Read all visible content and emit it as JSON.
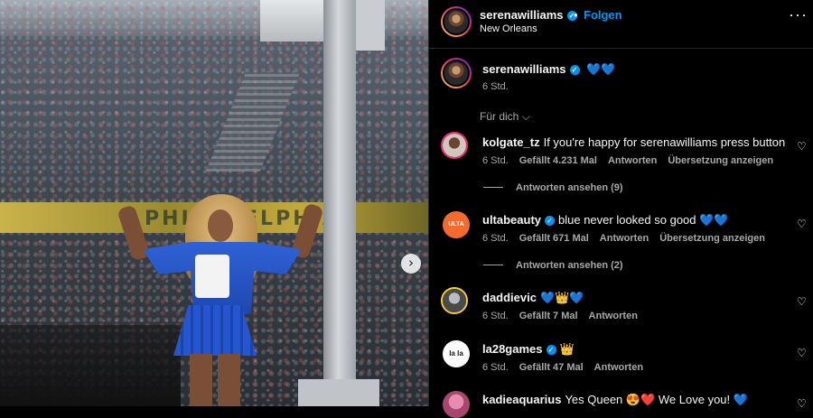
{
  "photo": {
    "banner_text": "PHILADELPHIA",
    "next_icon": "›"
  },
  "header": {
    "username": "serenawilliams",
    "verified_glyph": "✓",
    "dot": "•",
    "follow_label": "Folgen",
    "location": "New Orleans",
    "more_label": "···"
  },
  "caption": {
    "username": "serenawilliams",
    "text": "💙💙",
    "time": "6 Std."
  },
  "filter_label": "Für dich ⌵",
  "comments": [
    {
      "username": "kolgate_tz",
      "verified": false,
      "text": "If you're happy for serenawilliams press button",
      "time": "6 Std.",
      "likes": "Gefällt 4.231 Mal",
      "reply": "Antworten",
      "translate": "Übersetzung anzeigen",
      "replies_label": "Antworten ansehen (9)"
    },
    {
      "username": "ultabeauty",
      "verified": true,
      "text": "blue never looked so good 💙💙",
      "time": "6 Std.",
      "likes": "Gefällt 671 Mal",
      "reply": "Antworten",
      "translate": "Übersetzung anzeigen",
      "replies_label": "Antworten ansehen (2)",
      "avatar_text": "ULTA"
    },
    {
      "username": "daddievic",
      "verified": false,
      "text": "💙👑💙",
      "time": "6 Std.",
      "likes": "Gefällt 7 Mal",
      "reply": "Antworten"
    },
    {
      "username": "la28games",
      "verified": true,
      "text": "👑",
      "time": "6 Std.",
      "likes": "Gefällt 47 Mal",
      "reply": "Antworten",
      "avatar_text": "la la"
    },
    {
      "username": "kadieaquarius",
      "verified": false,
      "text": "Yes Queen 😍❤️ We Love you! 💙"
    }
  ],
  "heart_icon": "♡",
  "colors": {
    "accent": "#0095f6",
    "muted_text": "#a8a8a8",
    "background": "#000000"
  }
}
